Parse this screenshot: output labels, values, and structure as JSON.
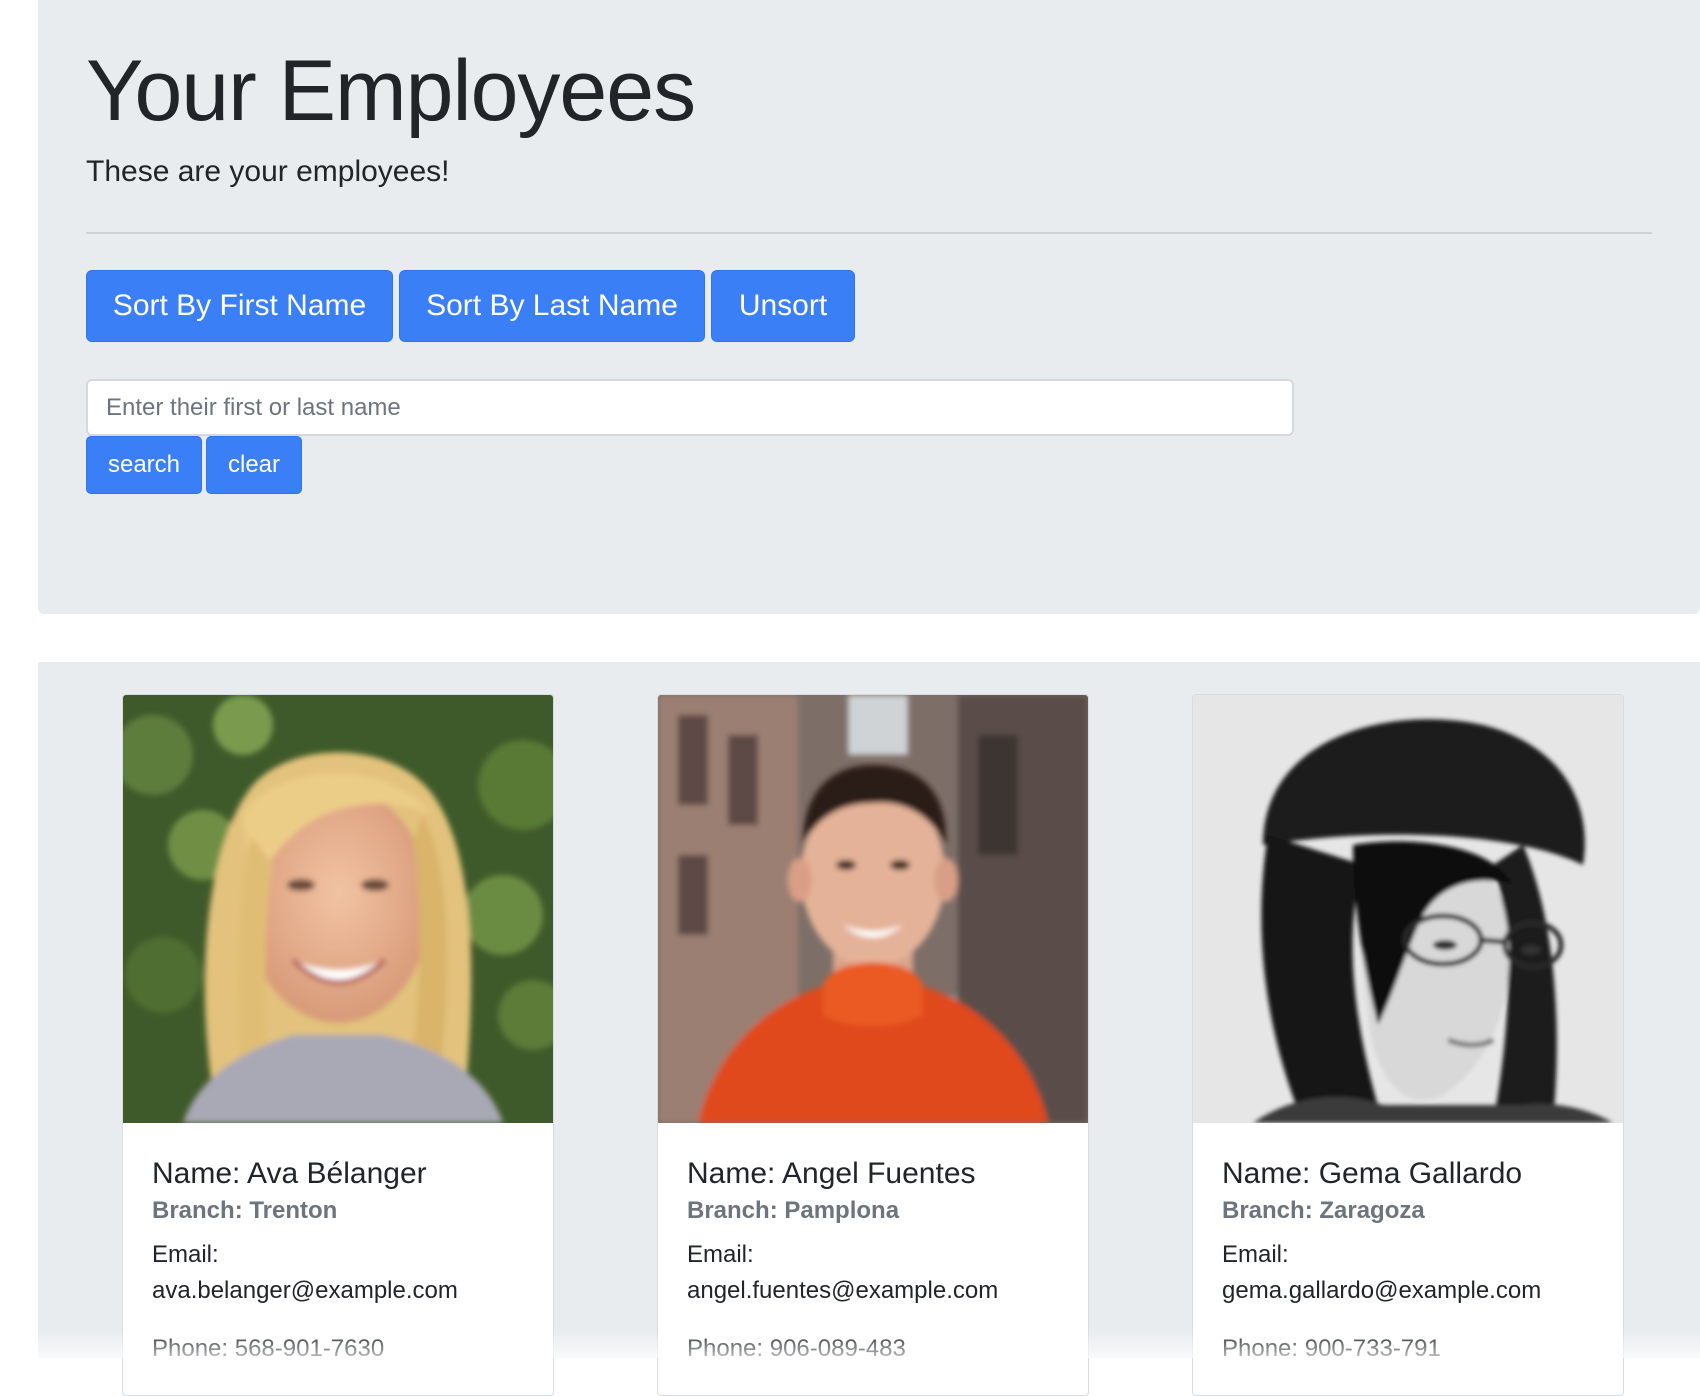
{
  "header": {
    "title": "Your Employees",
    "lead": "These are your employees!"
  },
  "sort_buttons": {
    "first_name": "Sort By First Name",
    "last_name": "Sort By Last Name",
    "unsort": "Unsort"
  },
  "search": {
    "placeholder": "Enter their first or last name",
    "value": "",
    "search_label": "search",
    "clear_label": "clear"
  },
  "colors": {
    "primary": "#3a7ff5",
    "jumbotron_bg": "#e9ecef",
    "muted_text": "#6c757d"
  },
  "employees": [
    {
      "name": "Name: Ava Bélanger",
      "branch": "Branch: Trenton",
      "email_label": "Email:",
      "email": "ava.belanger@example.com",
      "phone": "Phone: 568-901-7630"
    },
    {
      "name": "Name: Angel Fuentes",
      "branch": "Branch: Pamplona",
      "email_label": "Email:",
      "email": "angel.fuentes@example.com",
      "phone": "Phone: 906-089-483"
    },
    {
      "name": "Name: Gema Gallardo",
      "branch": "Branch: Zaragoza",
      "email_label": "Email:",
      "email": "gema.gallardo@example.com",
      "phone": "Phone: 900-733-791"
    }
  ]
}
